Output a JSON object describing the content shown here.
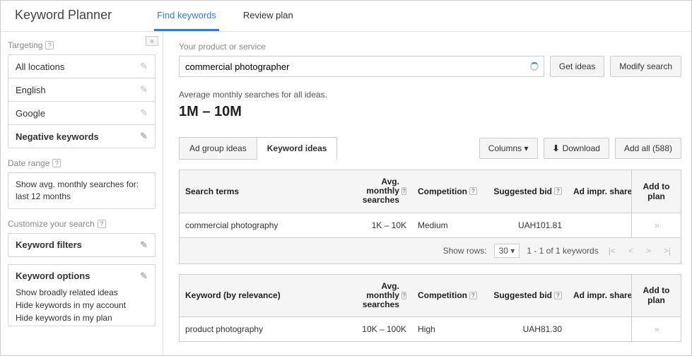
{
  "app_title": "Keyword Planner",
  "tabs": {
    "find": "Find keywords",
    "review": "Review plan"
  },
  "sidebar": {
    "collapse": "«",
    "targeting_label": "Targeting",
    "items": [
      {
        "label": "All locations"
      },
      {
        "label": "English"
      },
      {
        "label": "Google"
      },
      {
        "label": "Negative keywords"
      }
    ],
    "date_label": "Date range",
    "date_text": "Show avg. monthly searches for: last 12 months",
    "customize_label": "Customize your search",
    "filters_label": "Keyword filters",
    "options_label": "Keyword options",
    "option_subs": [
      "Show broadly related ideas",
      "Hide keywords in my account",
      "Hide keywords in my plan"
    ]
  },
  "search": {
    "label": "Your product or service",
    "value": "commercial photographer",
    "get_ideas": "Get ideas",
    "modify": "Modify search"
  },
  "avg": {
    "label": "Average monthly searches for all ideas.",
    "value": "1M – 10M"
  },
  "sub_tabs": {
    "ad_group": "Ad group ideas",
    "keyword": "Keyword ideas"
  },
  "right_buttons": {
    "columns": "Columns",
    "download": "Download",
    "add_all": "Add all (588)"
  },
  "headers": {
    "search_terms": "Search terms",
    "avg_monthly": "Avg. monthly searches",
    "competition": "Competition",
    "suggested_bid": "Suggested bid",
    "ad_impr": "Ad impr. share",
    "add_to_plan": "Add to plan",
    "keyword_rel": "Keyword (by relevance)"
  },
  "search_terms_rows": [
    {
      "term": "commercial photography",
      "searches": "1K – 10K",
      "competition": "Medium",
      "bid": "UAH101.81",
      "impr": ""
    }
  ],
  "keyword_rows": [
    {
      "term": "product photography",
      "searches": "10K – 100K",
      "competition": "High",
      "bid": "UAH81.30",
      "impr": ""
    }
  ],
  "pager": {
    "show_rows": "Show rows:",
    "rows_value": "30",
    "range": "1 - 1 of 1 keywords"
  }
}
